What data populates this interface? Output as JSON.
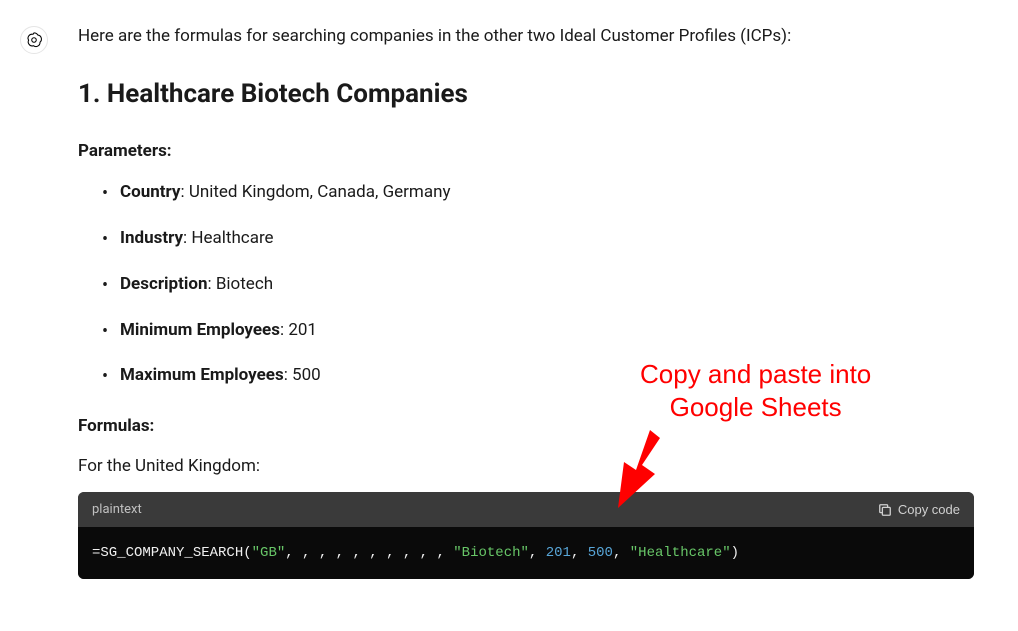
{
  "intro": "Here are the formulas for searching companies in the other two Ideal Customer Profiles (ICPs):",
  "section_heading": "1. Healthcare Biotech Companies",
  "parameters_label": "Parameters:",
  "parameters": [
    {
      "name": "Country",
      "value": "United Kingdom, Canada, Germany"
    },
    {
      "name": "Industry",
      "value": "Healthcare"
    },
    {
      "name": "Description",
      "value": "Biotech"
    },
    {
      "name": "Minimum Employees",
      "value": "201"
    },
    {
      "name": "Maximum Employees",
      "value": "500"
    }
  ],
  "formulas_label": "Formulas:",
  "formula_context": "For the United Kingdom:",
  "code": {
    "lang": "plaintext",
    "copy_label": "Copy code",
    "content_prefix": "=SG_COMPANY_SEARCH(",
    "arg_gb": "\"GB\"",
    "arg_empties": ", , , , , , , , , , ",
    "arg_biotech": "\"Biotech\"",
    "sep1": ", ",
    "arg_min": "201",
    "sep2": ", ",
    "arg_max": "500",
    "sep3": ", ",
    "arg_healthcare": "\"Healthcare\"",
    "content_suffix": ")"
  },
  "annotation": {
    "text_line1": "Copy and paste into",
    "text_line2": "Google Sheets"
  }
}
